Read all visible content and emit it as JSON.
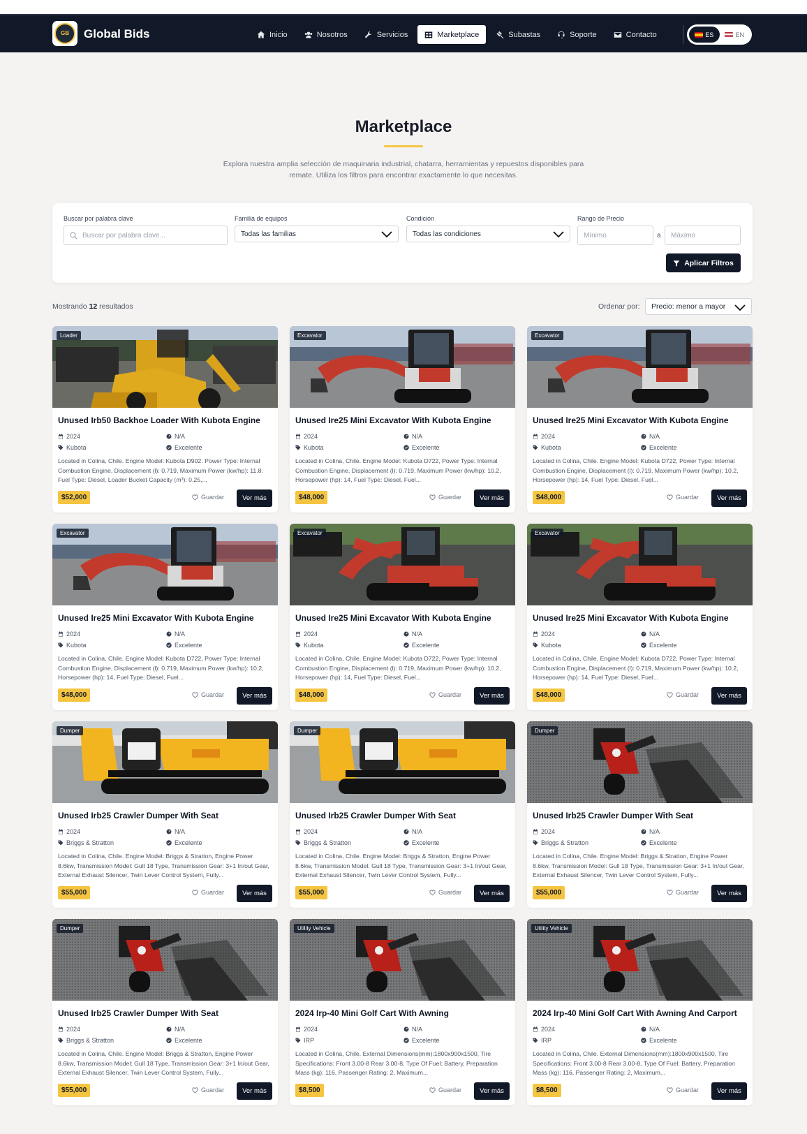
{
  "brand": {
    "name": "Global Bids",
    "logo_text": "GLOBAL BIDS"
  },
  "nav": {
    "items": [
      {
        "label": "Inicio",
        "icon": "home-icon",
        "active": false
      },
      {
        "label": "Nosotros",
        "icon": "users-icon",
        "active": false
      },
      {
        "label": "Servicios",
        "icon": "wrench-icon",
        "active": false
      },
      {
        "label": "Marketplace",
        "icon": "grid-icon",
        "active": true
      },
      {
        "label": "Subastas",
        "icon": "gavel-icon",
        "active": false
      },
      {
        "label": "Soporte",
        "icon": "headset-icon",
        "active": false
      },
      {
        "label": "Contacto",
        "icon": "envelope-icon",
        "active": false
      }
    ]
  },
  "lang": {
    "es": "ES",
    "en": "EN"
  },
  "hero": {
    "title": "Marketplace",
    "intro": "Explora nuestra amplia selección de maquinaria industrial, chatarra, herramientas y repuestos disponibles para remate. Utiliza los filtros para encontrar exactamente lo que necesitas."
  },
  "filters": {
    "keyword_label": "Buscar por palabra clave",
    "keyword_placeholder": "Buscar por palabra clave...",
    "family_label": "Familia de equipos",
    "family_value": "Todas las familias",
    "condition_label": "Condición",
    "condition_value": "Todas las condiciones",
    "price_label": "Rango de Precio",
    "min_placeholder": "Mínimo",
    "separator": "a",
    "max_placeholder": "Máximo",
    "apply_label": "Aplicar Filtros"
  },
  "results": {
    "prefix": "Mostrando",
    "count": "12",
    "suffix": "resultados",
    "sort_label": "Ordenar por:",
    "sort_value": "Precio: menor a mayor"
  },
  "card_labels": {
    "save": "Guardar",
    "more": "Ver más"
  },
  "colors": {
    "navy": "#111827",
    "accent": "#f5c542",
    "background": "#f5f3f1"
  },
  "listings": [
    {
      "category": "Loader",
      "title": "Unused Irb50 Backhoe Loader With Kubota Engine",
      "year": "2024",
      "hours": "N/A",
      "brand": "Kubota",
      "condition": "Excelente",
      "description": "Located in Colina, Chile. Engine Model: Kubota D902. Power Type: Internal Combustion Engine, Displacement (l): 0.719, Maximum Power (kw/hp): 11.8. Fuel Type: Diesel, Loader Bucket Capacity (m³): 0.25,...",
      "price": "$52,000",
      "photo": "loader"
    },
    {
      "category": "Excavator",
      "title": "Unused Ire25 Mini Excavator With Kubota Engine",
      "year": "2024",
      "hours": "N/A",
      "brand": "Kubota",
      "condition": "Excelente",
      "description": "Located in Colina, Chile. Engine Model: Kubota D722, Power Type: Internal Combustion Engine, Displacement (l): 0.719, Maximum Power (kw/hp): 10.2, Horsepower (hp): 14, Fuel Type: Diesel, Fuel...",
      "price": "$48,000",
      "photo": "excavator-side"
    },
    {
      "category": "Excavator",
      "title": "Unused Ire25 Mini Excavator With Kubota Engine",
      "year": "2024",
      "hours": "N/A",
      "brand": "Kubota",
      "condition": "Excelente",
      "description": "Located in Colina, Chile. Engine Model: Kubota D722, Power Type: Internal Combustion Engine, Displacement (l): 0.719, Maximum Power (kw/hp): 10.2, Horsepower (hp): 14, Fuel Type: Diesel, Fuel...",
      "price": "$48,000",
      "photo": "excavator-side"
    },
    {
      "category": "Excavator",
      "title": "Unused Ire25 Mini Excavator With Kubota Engine",
      "year": "2024",
      "hours": "N/A",
      "brand": "Kubota",
      "condition": "Excelente",
      "description": "Located in Colina, Chile. Engine Model: Kubota D722, Power Type: Internal Combustion Engine, Displacement (l): 0.719, Maximum Power (kw/hp): 10.2, Horsepower (hp): 14, Fuel Type: Diesel, Fuel...",
      "price": "$48,000",
      "photo": "excavator-side"
    },
    {
      "category": "Excavator",
      "title": "Unused Ire25 Mini Excavator With Kubota Engine",
      "year": "2024",
      "hours": "N/A",
      "brand": "Kubota",
      "condition": "Excelente",
      "description": "Located in Colina, Chile. Engine Model: Kubota D722, Power Type: Internal Combustion Engine, Displacement (l): 0.719, Maximum Power (kw/hp): 10.2, Horsepower (hp): 14, Fuel Type: Diesel, Fuel...",
      "price": "$48,000",
      "photo": "excavator-front"
    },
    {
      "category": "Excavator",
      "title": "Unused Ire25 Mini Excavator With Kubota Engine",
      "year": "2024",
      "hours": "N/A",
      "brand": "Kubota",
      "condition": "Excelente",
      "description": "Located in Colina, Chile. Engine Model: Kubota D722, Power Type: Internal Combustion Engine, Displacement (l): 0.719, Maximum Power (kw/hp): 10.2, Horsepower (hp): 14, Fuel Type: Diesel, Fuel...",
      "price": "$48,000",
      "photo": "excavator-front"
    },
    {
      "category": "Dumper",
      "title": "Unused Irb25 Crawler Dumper With Seat",
      "year": "2024",
      "hours": "N/A",
      "brand": "Briggs & Stratton",
      "condition": "Excelente",
      "description": "Located in Colina, Chile. Engine Model: Briggs & Stratton, Engine Power 8.6kw, Transmission Model: Gull 18 Type, Transmission Gear: 3+1 In/out Gear, External Exhaust Silencer, Twin Lever Control System, Fully...",
      "price": "$55,000",
      "photo": "dumper"
    },
    {
      "category": "Dumper",
      "title": "Unused Irb25 Crawler Dumper With Seat",
      "year": "2024",
      "hours": "N/A",
      "brand": "Briggs & Stratton",
      "condition": "Excelente",
      "description": "Located in Colina, Chile. Engine Model: Briggs & Stratton, Engine Power 8.6kw, Transmission Model: Gull 18 Type, Transmission Gear: 3+1 In/out Gear, External Exhaust Silencer, Twin Lever Control System, Fully...",
      "price": "$55,000",
      "photo": "dumper"
    },
    {
      "category": "Dumper",
      "title": "Unused Irb25 Crawler Dumper With Seat",
      "year": "2024",
      "hours": "N/A",
      "brand": "Briggs & Stratton",
      "condition": "Excelente",
      "description": "Located in Colina, Chile. Engine Model: Briggs & Stratton, Engine Power 8.6kw, Transmission Model: Gull 18 Type, Transmission Gear: 3+1 In/out Gear, External Exhaust Silencer, Twin Lever Control System, Fully...",
      "price": "$55,000",
      "photo": "cart"
    },
    {
      "category": "Dumper",
      "title": "Unused Irb25 Crawler Dumper With Seat",
      "year": "2024",
      "hours": "N/A",
      "brand": "Briggs & Stratton",
      "condition": "Excelente",
      "description": "Located in Colina, Chile. Engine Model: Briggs & Stratton, Engine Power 8.6kw, Transmission Model: Gull 18 Type, Transmission Gear: 3+1 In/out Gear, External Exhaust Silencer, Twin Lever Control System, Fully...",
      "price": "$55,000",
      "photo": "cart"
    },
    {
      "category": "Utility Vehicle",
      "title": "2024 Irp-40 Mini Golf Cart With Awning",
      "year": "2024",
      "hours": "N/A",
      "brand": "IRP",
      "condition": "Excelente",
      "description": "Located in Colina, Chile. External Dimensions(mm):1800x900x1500, Tire Specifications: Front 3.00-8 Rear 3.00-8, Type Of Fuel: Battery, Preparation Mass (kg): 116, Passenger Rating: 2, Maximum...",
      "price": "$8,500",
      "photo": "cart"
    },
    {
      "category": "Utility Vehicle",
      "title": "2024 Irp-40 Mini Golf Cart With Awning And Carport",
      "year": "2024",
      "hours": "N/A",
      "brand": "IRP",
      "condition": "Excelente",
      "description": "Located in Colina, Chile. External Dimensions(mm):1800x900x1500, Tire Specifications: Front 3.00-8 Rear 3.00-8, Type Of Fuel: Battery, Preparation Mass (kg): 116, Passenger Rating: 2, Maximum...",
      "price": "$8,500",
      "photo": "cart"
    }
  ]
}
